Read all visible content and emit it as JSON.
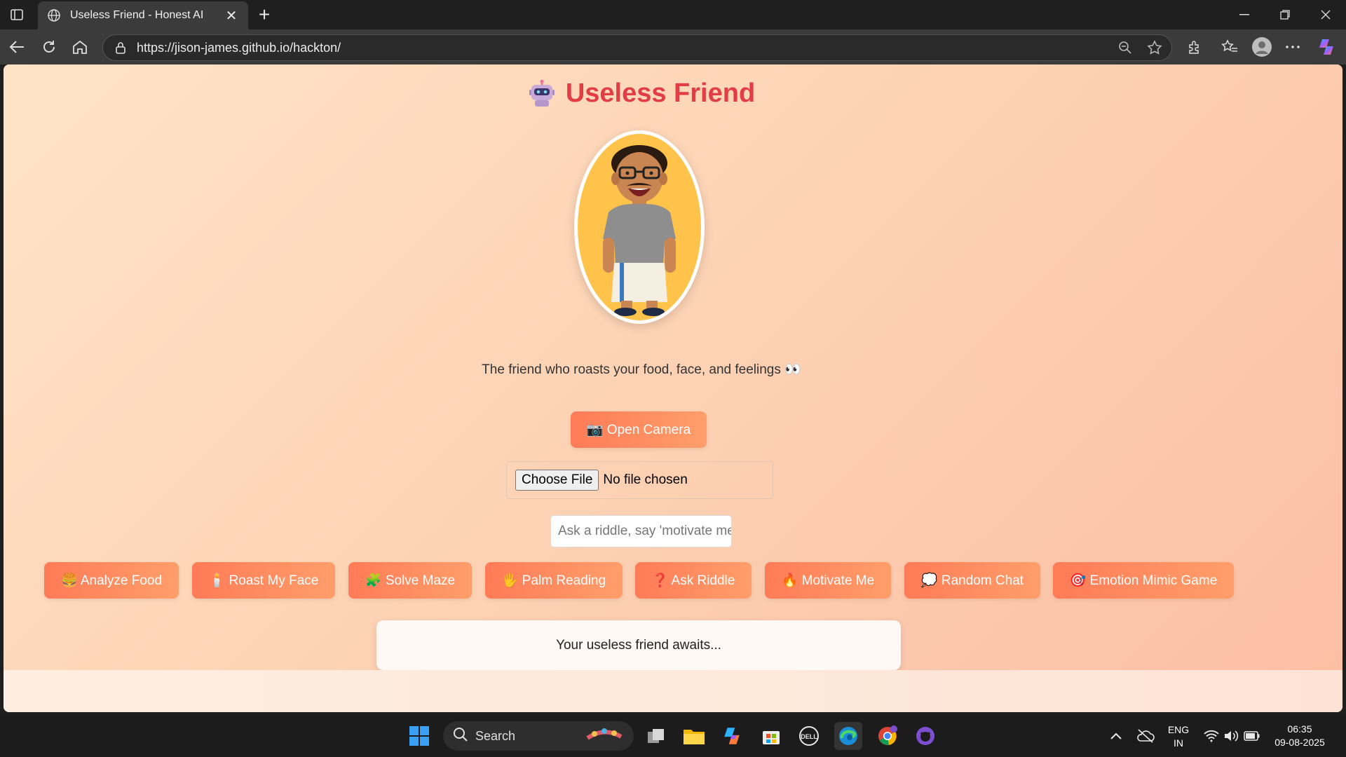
{
  "browser": {
    "tab_title": "Useless Friend - Honest AI",
    "url": "https://jison-james.github.io/hackton/"
  },
  "app": {
    "title": "Useless Friend",
    "tagline": "The friend who roasts your food, face, and feelings 👀",
    "open_camera_label": "📷 Open Camera",
    "choose_file_label": "Choose File",
    "file_status": "No file chosen",
    "input_placeholder": "Ask a riddle, say 'motivate me', or anything...",
    "actions": [
      {
        "label": "🍔 Analyze Food"
      },
      {
        "label": "🕯️ Roast My Face"
      },
      {
        "label": "🧩 Solve Maze"
      },
      {
        "label": "🖐️ Palm Reading"
      },
      {
        "label": "❓ Ask Riddle"
      },
      {
        "label": "🔥 Motivate Me"
      },
      {
        "label": "💭 Random Chat"
      },
      {
        "label": "🎯 Emotion Mimic Game"
      }
    ],
    "output_text": "Your useless friend awaits..."
  },
  "taskbar": {
    "search_label": "Search",
    "lang_line1": "ENG",
    "lang_line2": "IN",
    "time": "06:35",
    "date": "09-08-2025"
  },
  "colors": {
    "title": "#e23c45",
    "button_start": "#ff7b57",
    "button_end": "#ff9e6a",
    "avatar_bg": "#ffc24b"
  }
}
